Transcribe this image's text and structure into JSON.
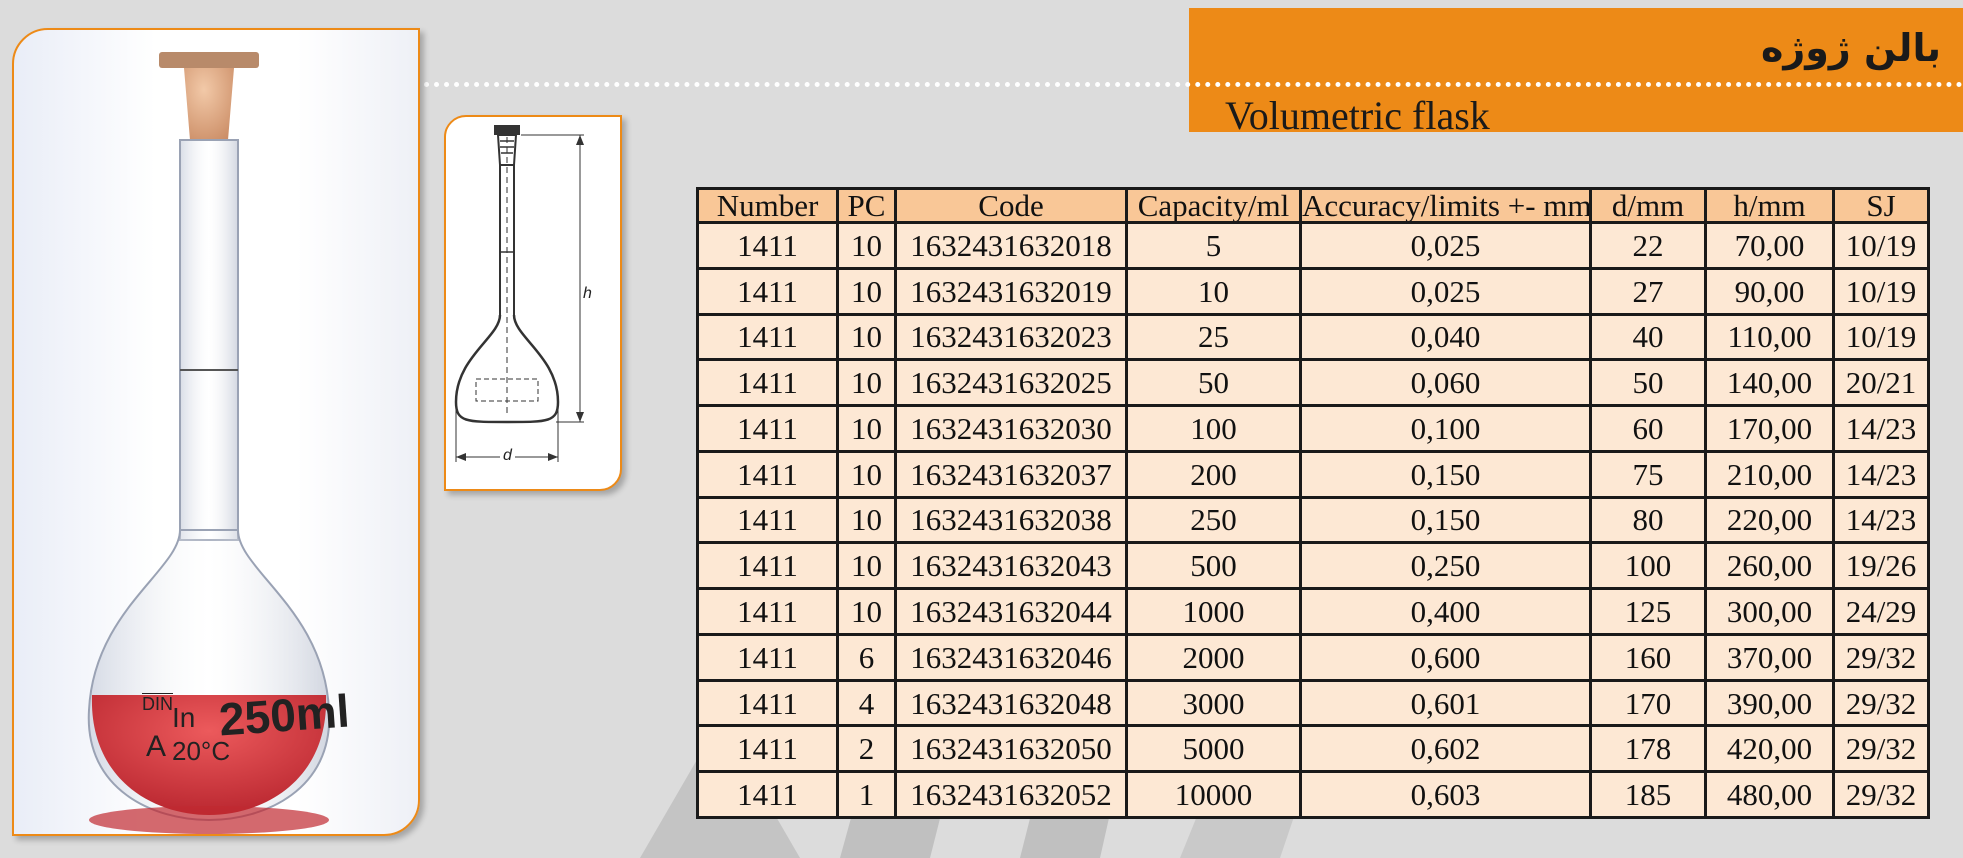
{
  "header": {
    "title_fa": "بالن ژوژه",
    "title_en": "Volumetric flask",
    "accent_color": "#ed8a17"
  },
  "photo": {
    "markings": {
      "volume": "250ml",
      "in": "In",
      "din": "DIN",
      "class": "A",
      "temp": "20°C"
    },
    "liquid_color": "#d8353e"
  },
  "diagram": {
    "label_h": "h",
    "label_d": "d"
  },
  "table": {
    "headers": [
      "Number",
      "PC",
      "Code",
      "Capacity/ml",
      "Accuracy/limits +- mm",
      "d/mm",
      "h/mm",
      "SJ"
    ],
    "rows": [
      [
        "1411",
        "10",
        "1632431632018",
        "5",
        "0,025",
        "22",
        "70,00",
        "10/19"
      ],
      [
        "1411",
        "10",
        "1632431632019",
        "10",
        "0,025",
        "27",
        "90,00",
        "10/19"
      ],
      [
        "1411",
        "10",
        "1632431632023",
        "25",
        "0,040",
        "40",
        "110,00",
        "10/19"
      ],
      [
        "1411",
        "10",
        "1632431632025",
        "50",
        "0,060",
        "50",
        "140,00",
        "20/21"
      ],
      [
        "1411",
        "10",
        "1632431632030",
        "100",
        "0,100",
        "60",
        "170,00",
        "14/23"
      ],
      [
        "1411",
        "10",
        "1632431632037",
        "200",
        "0,150",
        "75",
        "210,00",
        "14/23"
      ],
      [
        "1411",
        "10",
        "1632431632038",
        "250",
        "0,150",
        "80",
        "220,00",
        "14/23"
      ],
      [
        "1411",
        "10",
        "1632431632043",
        "500",
        "0,250",
        "100",
        "260,00",
        "19/26"
      ],
      [
        "1411",
        "10",
        "1632431632044",
        "1000",
        "0,400",
        "125",
        "300,00",
        "24/29"
      ],
      [
        "1411",
        "6",
        "1632431632046",
        "2000",
        "0,600",
        "160",
        "370,00",
        "29/32"
      ],
      [
        "1411",
        "4",
        "1632431632048",
        "3000",
        "0,601",
        "170",
        "390,00",
        "29/32"
      ],
      [
        "1411",
        "2",
        "1632431632050",
        "5000",
        "0,602",
        "178",
        "420,00",
        "29/32"
      ],
      [
        "1411",
        "1",
        "1632431632052",
        "10000",
        "0,603",
        "185",
        "480,00",
        "29/32"
      ]
    ]
  }
}
